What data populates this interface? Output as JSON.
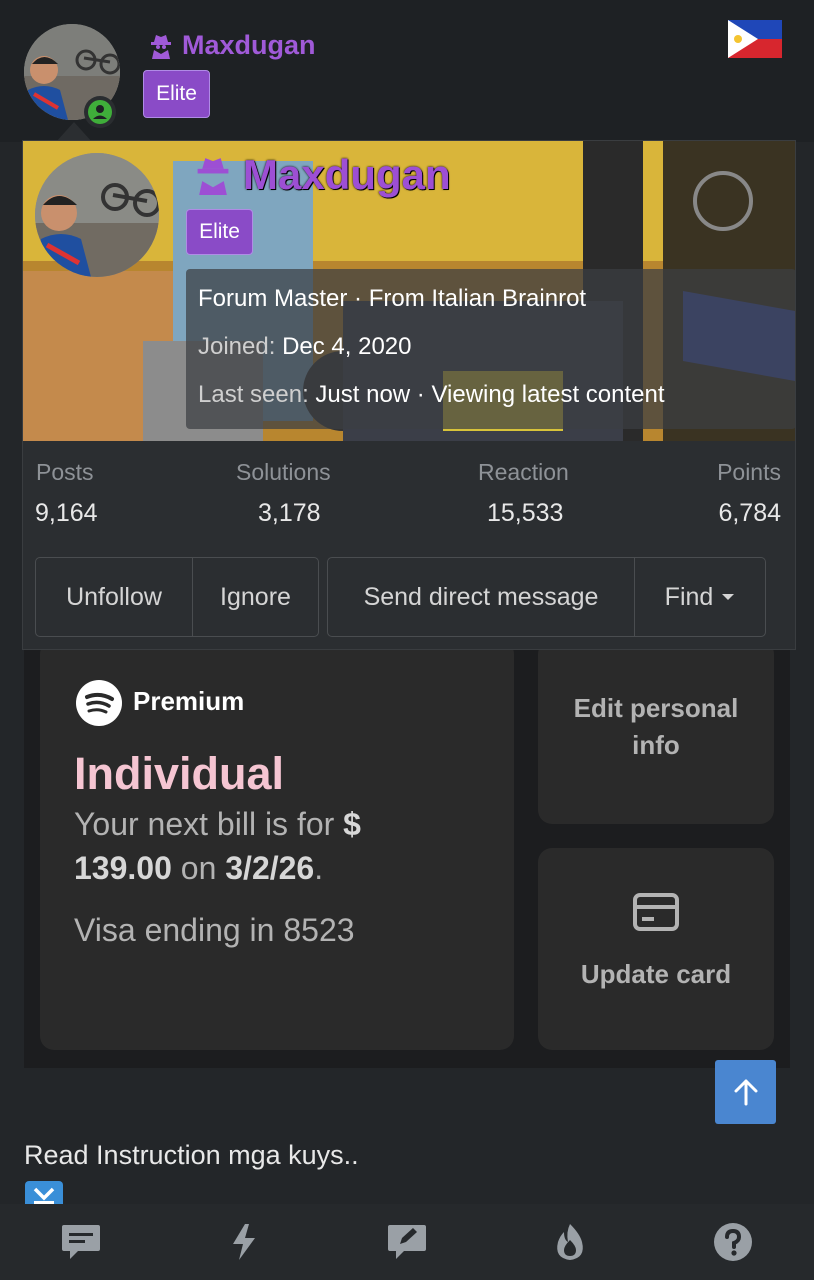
{
  "header": {
    "username": "Maxdugan",
    "badge": "Elite",
    "flag": "philippines-flag",
    "online_status": "online"
  },
  "popup": {
    "username": "Maxdugan",
    "badge": "Elite",
    "title_line": {
      "rank": "Forum Master",
      "separator": " · ",
      "location": "From Italian Brainrot"
    },
    "joined": {
      "label": "Joined:",
      "value": "Dec 4, 2020"
    },
    "last_seen": {
      "label": "Last seen:",
      "value": "Just now · Viewing latest content"
    },
    "stats": [
      {
        "label": "Posts",
        "value": "9,164"
      },
      {
        "label": "Solutions",
        "value": "3,178"
      },
      {
        "label": "Reaction",
        "value": "15,533"
      },
      {
        "label": "Points",
        "value": "6,784"
      }
    ],
    "buttons": {
      "unfollow": "Unfollow",
      "ignore": "Ignore",
      "send_message": "Send direct message",
      "find": "Find"
    }
  },
  "spotify": {
    "premium_label": "Premium",
    "plan": "Individual",
    "bill_prefix": "Your next bill is for",
    "currency": "$",
    "amount": "139.00",
    "on_word": "on",
    "date": "3/2/26",
    "period": ".",
    "visa": "Visa ending in 8523",
    "edit_info": "Edit personal info",
    "update_card": "Update card"
  },
  "post": {
    "text": "Read Instruction mga kuys.."
  },
  "nav": [
    "chat-icon",
    "bolt-icon",
    "edit-icon",
    "fire-icon",
    "help-icon"
  ],
  "colors": {
    "username_purple": "#a05ad8",
    "elite_badge": "#8a4bc7",
    "plan_pink": "#f5c5d2",
    "scroll_button": "#4a86d0"
  }
}
